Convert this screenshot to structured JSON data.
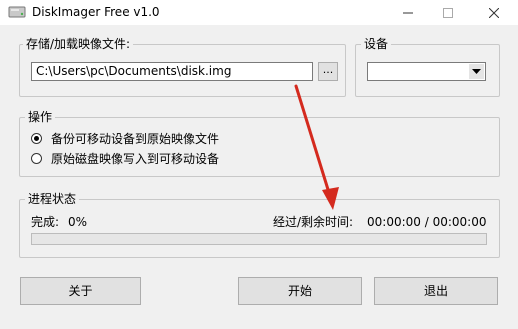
{
  "window": {
    "title": "DiskImager Free v1.0",
    "icon": "disk-imager-icon",
    "controls": [
      "minimize-icon",
      "maximize-icon",
      "close-icon"
    ]
  },
  "image_file": {
    "group_label": "存储/加载映像文件:",
    "path_value": "C:\\Users\\pc\\Documents\\disk.img",
    "browse_label": "..."
  },
  "device": {
    "group_label": "设备",
    "selected_value": ""
  },
  "operation": {
    "group_label": "操作",
    "options": [
      {
        "label": "备份可移动设备到原始映像文件",
        "selected": true
      },
      {
        "label": "原始磁盘映像写入到可移动设备",
        "selected": false
      }
    ]
  },
  "progress": {
    "group_label": "进程状态",
    "complete_label": "完成:",
    "complete_value": "0%",
    "complete_fraction": 0,
    "time_label": "经过/剩余时间:",
    "time_value": "00:00:00 / 00:00:00"
  },
  "buttons": {
    "about": "关于",
    "start": "开始",
    "exit": "退出"
  },
  "colors": {
    "annotation_arrow": "#d42a1e",
    "window_bg": "#f0f0f0",
    "progress_fill": "#06b025"
  }
}
